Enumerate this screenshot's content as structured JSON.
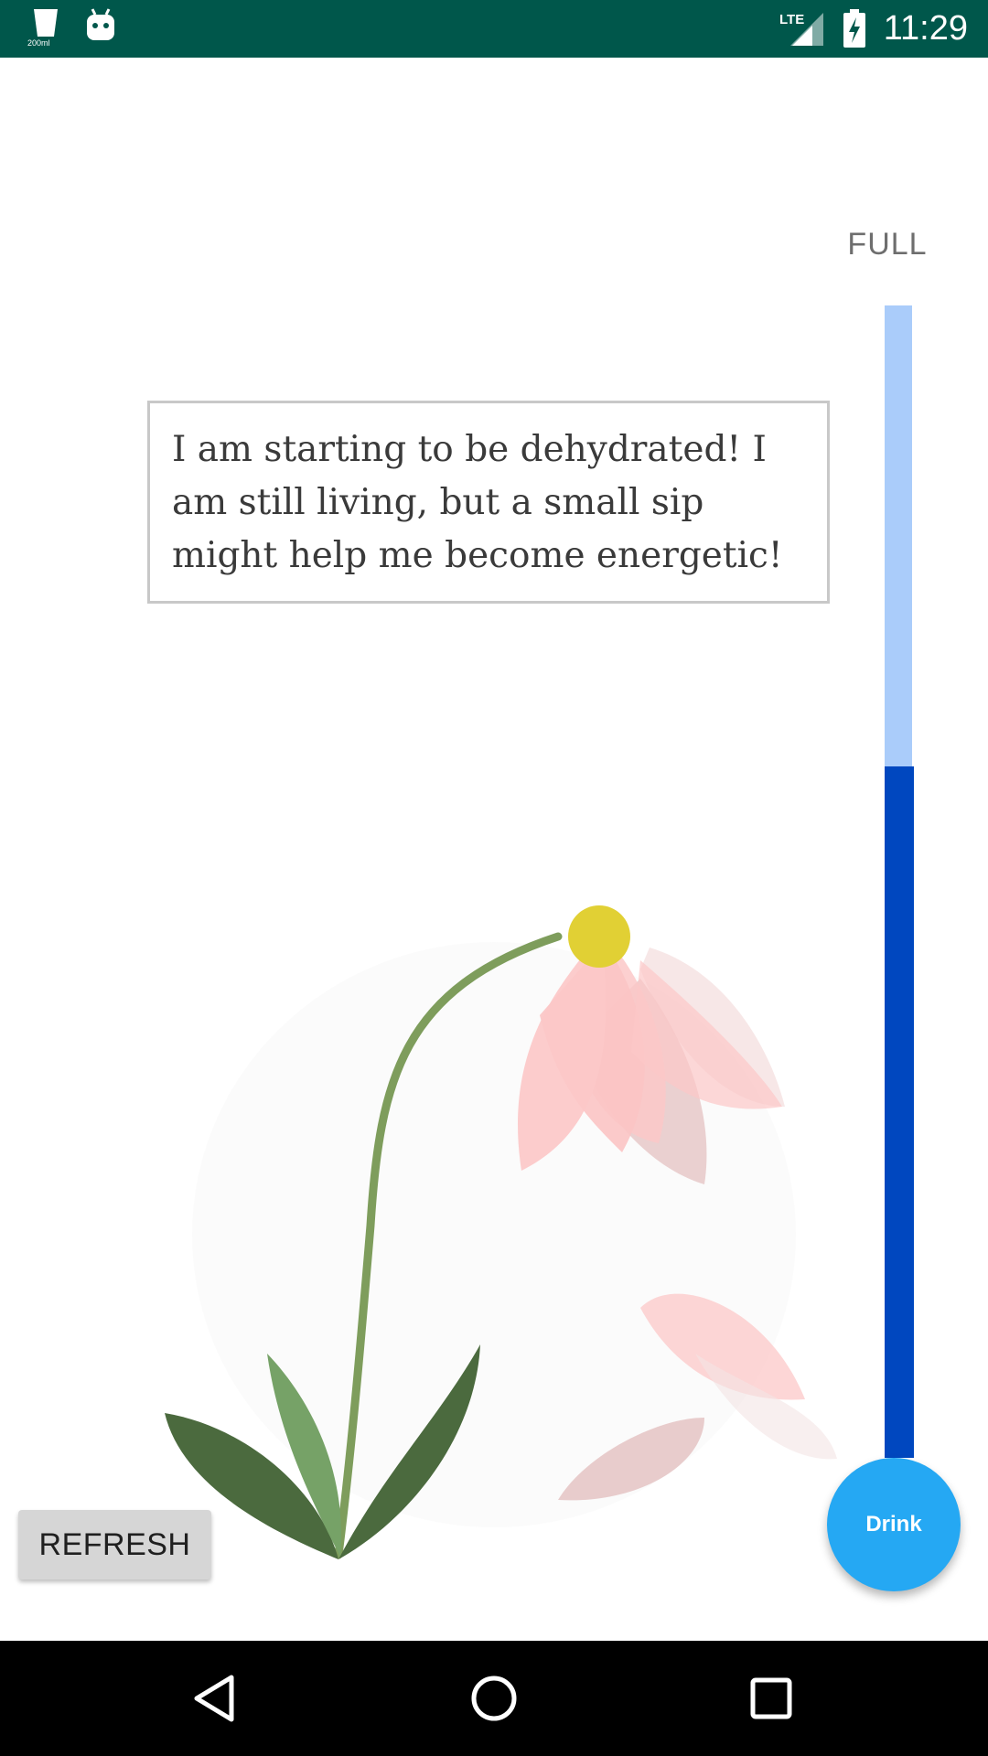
{
  "status_bar": {
    "time": "11:29",
    "water_icon_label": "200ml",
    "icons": [
      "water-cup-icon",
      "android-icon",
      "lte-signal-icon",
      "battery-charging-icon"
    ]
  },
  "level": {
    "label": "FULL",
    "fill_fraction": 0.6,
    "track_color": "#aaccfa",
    "fill_color": "#0047bf"
  },
  "message": {
    "text": "I am starting to be dehydrated! I am still living, but a small sip might help me become energetic!"
  },
  "buttons": {
    "refresh_label": "REFRESH",
    "drink_label": "Drink"
  },
  "colors": {
    "status_bar": "#00574b",
    "fab": "#25a8f3",
    "flower_center": "#e1d034",
    "petal": "#fcc8c8",
    "stem": "#7e9d5c",
    "leaf_dark": "#4b6a3e",
    "leaf_light": "#76a267"
  },
  "nav": {
    "icons": [
      "back-icon",
      "home-icon",
      "recents-icon"
    ]
  }
}
